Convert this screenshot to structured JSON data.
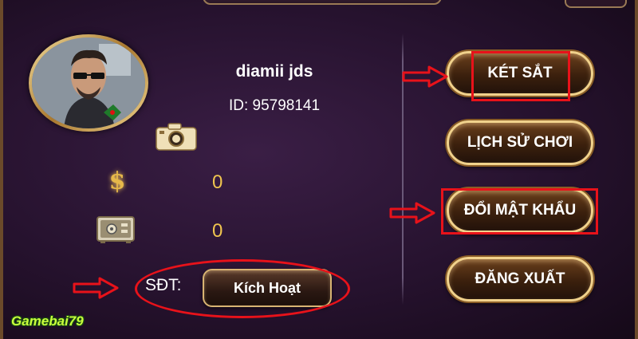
{
  "profile": {
    "username": "diamii jds",
    "id_text": "ID: 95798141"
  },
  "balances": {
    "money_symbol": "$",
    "money_value": "0",
    "safe_value": "0"
  },
  "phone": {
    "label": "SĐT:",
    "activate_label": "Kích Hoạt"
  },
  "menu": {
    "ket_sat": "KÉT SẮT",
    "lich_su_choi": "LỊCH SỬ CHƠI",
    "doi_mat_khau": "ĐỔI MẬT KHẨU",
    "dang_xuat": "ĐĂNG XUẤT"
  },
  "watermark": "Gamebai79",
  "colors": {
    "highlight": "#e8121a",
    "gold": "#f0c54f",
    "panel": "#26122e"
  },
  "icons": [
    "camera-icon",
    "dollar-icon",
    "safe-icon",
    "arrow-right-icon"
  ]
}
